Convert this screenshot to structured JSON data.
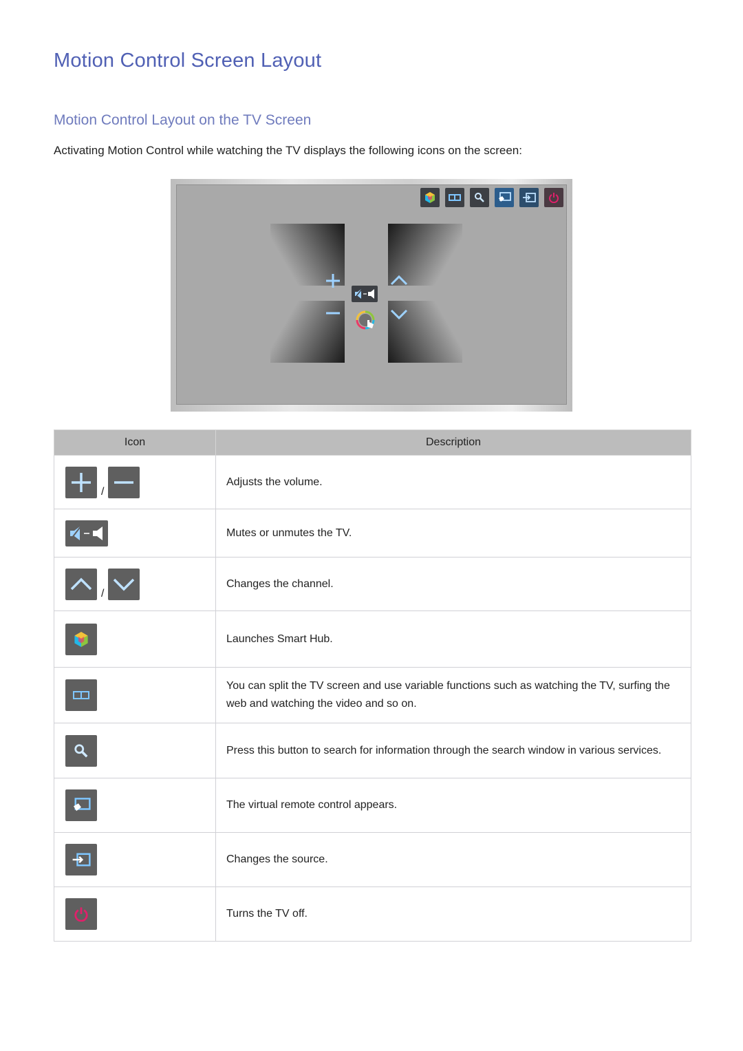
{
  "page": {
    "title": "Motion Control Screen Layout",
    "section_title": "Motion Control Layout on the TV Screen",
    "intro": "Activating Motion Control while watching the TV displays the following icons on the screen:"
  },
  "tv_illustration": {
    "top_icons": [
      "smart-hub-icon",
      "split-screen-icon",
      "search-icon",
      "virtual-remote-icon",
      "source-icon",
      "power-icon"
    ],
    "center_icons": [
      "volume-up-icon",
      "volume-down-icon",
      "channel-up-icon",
      "channel-down-icon",
      "mute-toggle-icon",
      "motion-pointer-icon"
    ]
  },
  "colors": {
    "heading": "#5060b4",
    "subheading": "#6f7bbd",
    "icon_glow": "#3aa0ff",
    "power": "#e0206a",
    "table_header_bg": "#bcbcbc"
  },
  "table": {
    "headers": {
      "icon": "Icon",
      "description": "Description"
    },
    "separator": "/",
    "rows": [
      {
        "icons": [
          "volume-up-icon",
          "volume-down-icon"
        ],
        "description": "Adjusts the volume."
      },
      {
        "icons": [
          "mute-toggle-icon"
        ],
        "description": "Mutes or unmutes the TV."
      },
      {
        "icons": [
          "channel-up-icon",
          "channel-down-icon"
        ],
        "description": "Changes the channel."
      },
      {
        "icons": [
          "smart-hub-icon"
        ],
        "description": "Launches Smart Hub."
      },
      {
        "icons": [
          "split-screen-icon"
        ],
        "description": "You can split the TV screen and use variable functions such as watching the TV, surfing the web and watching the video and so on."
      },
      {
        "icons": [
          "search-icon"
        ],
        "description": "Press this button to search for information through the search window in various services."
      },
      {
        "icons": [
          "virtual-remote-icon"
        ],
        "description": "The virtual remote control appears."
      },
      {
        "icons": [
          "source-icon"
        ],
        "description": "Changes the source."
      },
      {
        "icons": [
          "power-icon"
        ],
        "description": "Turns the TV off."
      }
    ]
  }
}
